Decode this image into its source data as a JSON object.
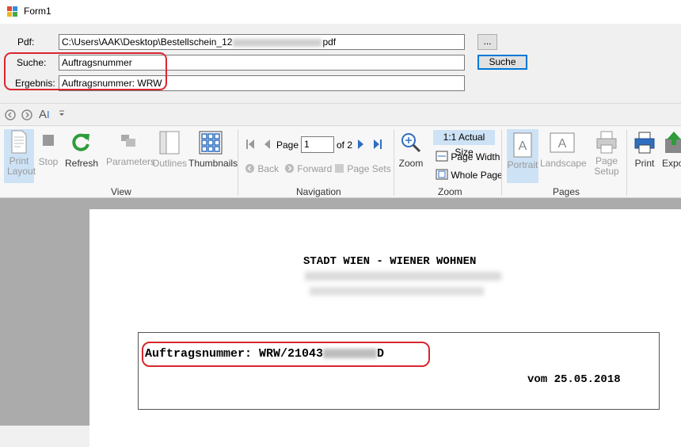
{
  "window": {
    "title": "Form1"
  },
  "form": {
    "pdf_label": "Pdf:",
    "pdf_path_start": "C:\\Users\\AAK\\Desktop\\Bestellschein_12",
    "pdf_path_end": "pdf",
    "browse_label": "...",
    "search_label": "Suche:",
    "search_value": "Auftragsnummer",
    "search_button": "Suche",
    "result_label": "Ergebnis:",
    "result_value": "Auftragsnummer: WRW"
  },
  "minibar": {
    "find_glyph": "A"
  },
  "ribbon": {
    "view": {
      "group": "View",
      "print_layout": "Print Layout",
      "stop": "Stop",
      "refresh": "Refresh",
      "parameters": "Parameters",
      "outlines": "Outlines",
      "thumbnails": "Thumbnails"
    },
    "navigation": {
      "group": "Navigation",
      "page_label": "Page",
      "page_value": "1",
      "of_pages": "of 2",
      "back": "Back",
      "forward": "Forward",
      "page_sets": "Page Sets"
    },
    "zoom": {
      "group": "Zoom",
      "zoom": "Zoom",
      "actual_size": "1:1 Actual Size",
      "page_width": "Page Width",
      "whole_page": "Whole Page"
    },
    "pages": {
      "group": "Pages",
      "portrait": "Portrait",
      "landscape": "Landscape",
      "page_setup": "Page Setup"
    },
    "print": "Print",
    "export": "Expo"
  },
  "document": {
    "title": "STADT WIEN - WIENER WOHNEN",
    "order_prefix": "Auftragsnummer: WRW/21043",
    "order_suffix": "D",
    "date": "vom 25.05.2018"
  },
  "colors": {
    "highlight": "#d9262e",
    "accent": "#0078d7",
    "selected": "#cde2f5"
  }
}
